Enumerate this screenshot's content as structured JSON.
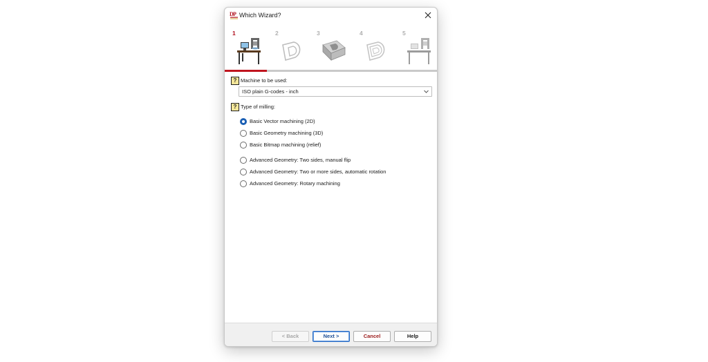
{
  "window": {
    "title": "Which Wizard?"
  },
  "steps": [
    {
      "number": "1",
      "active": true,
      "icon": "machine-desk-icon"
    },
    {
      "number": "2",
      "active": false,
      "icon": "vector-shape-icon"
    },
    {
      "number": "3",
      "active": false,
      "icon": "geometry-block-icon"
    },
    {
      "number": "4",
      "active": false,
      "icon": "toolpath-shape-icon"
    },
    {
      "number": "5",
      "active": false,
      "icon": "machine-desk-icon"
    }
  ],
  "progress": {
    "fraction": 0.2
  },
  "machine": {
    "help": "?",
    "label": "Machine to be used:",
    "selected": "ISO plain G-codes - inch"
  },
  "milling": {
    "help": "?",
    "label": "Type of milling:",
    "options": [
      {
        "label": "Basic Vector machining (2D)",
        "checked": true
      },
      {
        "label": "Basic Geometry machining (3D)",
        "checked": false
      },
      {
        "label": "Basic Bitmap machining (relief)",
        "checked": false
      },
      {
        "label": "Advanced Geometry: Two sides, manual flip",
        "checked": false
      },
      {
        "label": "Advanced Geometry: Two or more sides, automatic rotation",
        "checked": false
      },
      {
        "label": "Advanced Geometry: Rotary machining",
        "checked": false
      }
    ]
  },
  "buttons": {
    "back": "< Back",
    "next": "Next >",
    "cancel": "Cancel",
    "help": "Help"
  },
  "colors": {
    "accent": "#c0141e",
    "radio_checked": "#1a5fb4",
    "help_icon_bg": "#f5e79a"
  }
}
